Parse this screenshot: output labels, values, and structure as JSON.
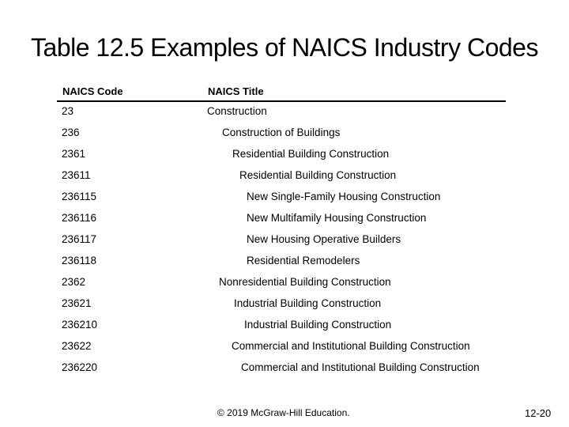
{
  "title": "Table 12.5 Examples of NAICS Industry Codes",
  "table": {
    "headers": {
      "code": "NAICS Code",
      "title": "NAICS Title"
    },
    "rows": [
      {
        "code": "23",
        "title": "Construction",
        "level": 0
      },
      {
        "code": "236",
        "title": "Construction of Buildings",
        "level": 1
      },
      {
        "code": "2361",
        "title": "Residential Building Construction",
        "level": 2
      },
      {
        "code": "23611",
        "title": "Residential Building Construction",
        "level": 3
      },
      {
        "code": "236115",
        "title": "New Single-Family Housing Construction",
        "level": 4
      },
      {
        "code": "236116",
        "title": "New Multifamily Housing Construction",
        "level": 4
      },
      {
        "code": "236117",
        "title": "New Housing Operative Builders",
        "level": 4
      },
      {
        "code": "236118",
        "title": "Residential Remodelers",
        "level": 4
      },
      {
        "code": "2362",
        "title": "Nonresidential Building Construction",
        "level": 2
      },
      {
        "code": "23621",
        "title": "Industrial Building Construction",
        "level": 3
      },
      {
        "code": "236210",
        "title": "Industrial Building Construction",
        "level": 4
      },
      {
        "code": "23622",
        "title": "Commercial and Institutional Building Construction",
        "level": 3
      },
      {
        "code": "236220",
        "title": "Commercial and Institutional Building Construction",
        "level": 4
      }
    ]
  },
  "footer": {
    "copyright": "© 2019 McGraw-Hill Education.",
    "page_number": "12-20"
  }
}
